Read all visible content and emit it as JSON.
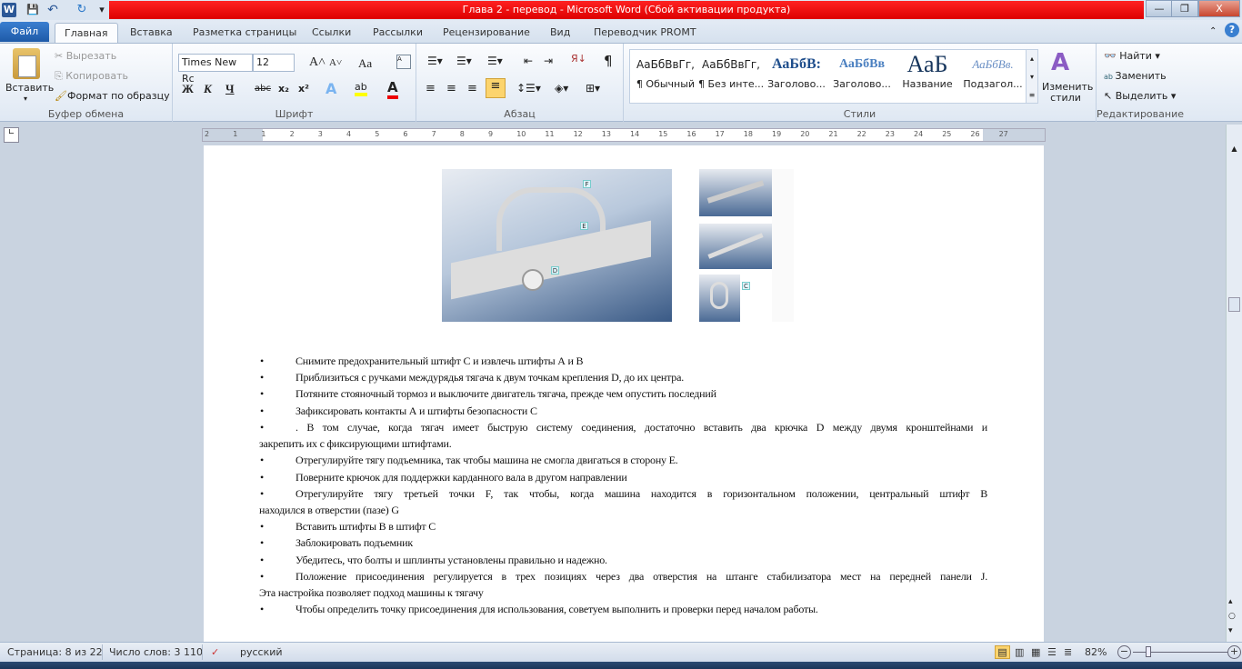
{
  "window": {
    "title": "Глава 2 - перевод  -  Microsoft Word (Сбой активации продукта)",
    "minimize": "—",
    "restore": "❐",
    "close": "X"
  },
  "quick_access": {
    "word_icon": "W",
    "save": "💾",
    "undo": "↶",
    "redo": "↻",
    "customize": "▾"
  },
  "tabs": [
    "Файл",
    "Главная",
    "Вставка",
    "Разметка страницы",
    "Ссылки",
    "Рассылки",
    "Рецензирование",
    "Вид",
    "Переводчик PROMT"
  ],
  "clipboard": {
    "paste": "Вставить",
    "cut": "Вырезать",
    "copy": "Копировать",
    "format_painter": "Формат по образцу",
    "label": "Буфер обмена"
  },
  "font": {
    "name": "Times New Rc",
    "size": "12",
    "bold": "Ж",
    "italic": "К",
    "underline": "Ч",
    "strike": "abc",
    "sub": "x₂",
    "sup": "x²",
    "grow": "A˄",
    "shrink": "A˅",
    "case": "Aa",
    "label": "Шрифт"
  },
  "paragraph": {
    "label": "Абзац",
    "pilcrow": "¶"
  },
  "styles": {
    "items": [
      {
        "sample": "АаБбВвГг,",
        "name": "¶ Обычный"
      },
      {
        "sample": "АаБбВвГг,",
        "name": "¶ Без инте..."
      },
      {
        "sample": "АаБбВ:",
        "name": "Заголово..."
      },
      {
        "sample": "АаБбВв",
        "name": "Заголово..."
      },
      {
        "sample": "АаБ",
        "name": "Название"
      },
      {
        "sample": "АаБбВв.",
        "name": "Подзагол..."
      }
    ],
    "change": "Изменить стили",
    "label": "Стили"
  },
  "editing": {
    "find": "Найти",
    "replace": "Заменить",
    "select": "Выделить",
    "label": "Редактирование"
  },
  "ruler": {
    "ticks": [
      "2",
      "1",
      "1",
      "2",
      "3",
      "4",
      "5",
      "6",
      "7",
      "8",
      "9",
      "10",
      "11",
      "12",
      "13",
      "14",
      "15",
      "16",
      "17",
      "18",
      "19",
      "20",
      "21",
      "22",
      "23",
      "24",
      "25",
      "26",
      "27"
    ]
  },
  "figure": {
    "callouts": [
      "F",
      "E",
      "D",
      "A",
      "B",
      "C"
    ]
  },
  "document": {
    "bullet": "•",
    "items": [
      "Снимите предохранительный штифт С и извлечь штифты А и В",
      "Приблизиться с ручками междурядья тягача к двум точкам крепления  D, до их центра.",
      "Потяните стояночный тормоз и выключите двигатель тягача, прежде чем опустить последний",
      "Зафиксировать контакты А и штифты безопасности С",
      " . В том случае, когда тягач имеет быструю систему соединения, достаточно вставить два крючка D между двумя кронштейнами и",
      "Отрегулируйте тягу подъемника, так чтобы машина не смогла двигаться в сторону Е.",
      "Поверните крючок для поддержки карданного вала в другом направлении",
      "Отрегулируйте тягу третьей точки F, так чтобы, когда машина находится в горизонтальном положении,   центральный штифт B",
      "Вставить штифты B в штифт С",
      "Заблокировать подъемник",
      "Убедитесь, что болты и шплинты установлены правильно и надежно.",
      "Положение присоединения регулируется в трех позициях через два отверстия на штанге стабилизатора мест на передней панели J.",
      "Чтобы определить точку присоединения для использования, советуем выполнить и проверки перед началом работы."
    ],
    "continuations": {
      "4": "закрепить их с фиксирующими штифтами.",
      "7": "находился в отверстии (пазе) G",
      "11": "Эта настройка позволяет подход машины к тягачу"
    }
  },
  "status": {
    "page": "Страница: 8 из 22",
    "words": "Число слов: 3 110",
    "language": "русский",
    "zoom": "82%",
    "zoom_percent": 82
  }
}
